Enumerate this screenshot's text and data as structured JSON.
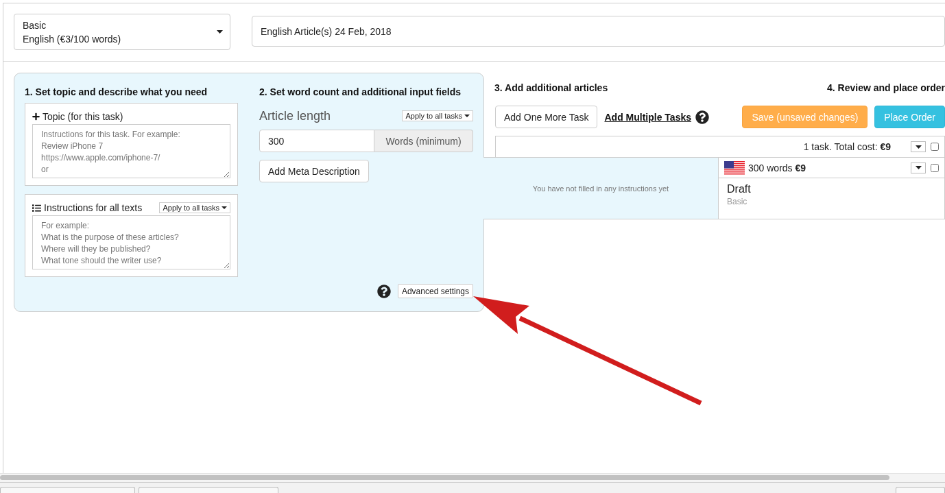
{
  "order": {
    "service_select": {
      "plan": "Basic",
      "language": "English (€3/100 words)"
    },
    "title_field": {
      "value": "English Article(s) 24 Feb, 2018"
    }
  },
  "step_1": {
    "heading": "1. Set topic and describe what you need",
    "topic": {
      "label": "Topic (for this task)",
      "placeholder": "Instructions for this task. For example:\nReview iPhone 7\nhttps://www.apple.com/iphone-7/\nor"
    },
    "instructions": {
      "label": "Instructions for all texts",
      "apply_button": "Apply to all tasks",
      "placeholder": "For example:\nWhat is the purpose of these articles?\nWhere will they be published?\nWhat tone should the writer use?"
    }
  },
  "step_2": {
    "heading": "2. Set word count and additional input fields",
    "article_length": {
      "label": "Article length",
      "apply_button": "Apply to all tasks",
      "value": "300",
      "unit": "Words (minimum)"
    },
    "meta_button": "Add Meta Description",
    "advanced_button": "Advanced settings"
  },
  "step_3": {
    "heading": "3. Add additional articles",
    "add_button": "Add One More Task",
    "multiple_link": "Add Multiple Tasks"
  },
  "step_4": {
    "heading": "4. Review and place order",
    "buttons": [
      {
        "label": "Save (unsaved changes)",
        "kind": "warning"
      },
      {
        "label": "Place Order",
        "kind": "primary"
      }
    ]
  },
  "task_list": {
    "summary": {
      "text": "1 task. Total cost: **€9**",
      "checked": false
    },
    "tasks": [
      {
        "empty_note": "You have not filled in any instructions yet",
        "title": "300 words **€9**",
        "checked": false,
        "status": "Draft",
        "plan": "Basic"
      }
    ]
  }
}
